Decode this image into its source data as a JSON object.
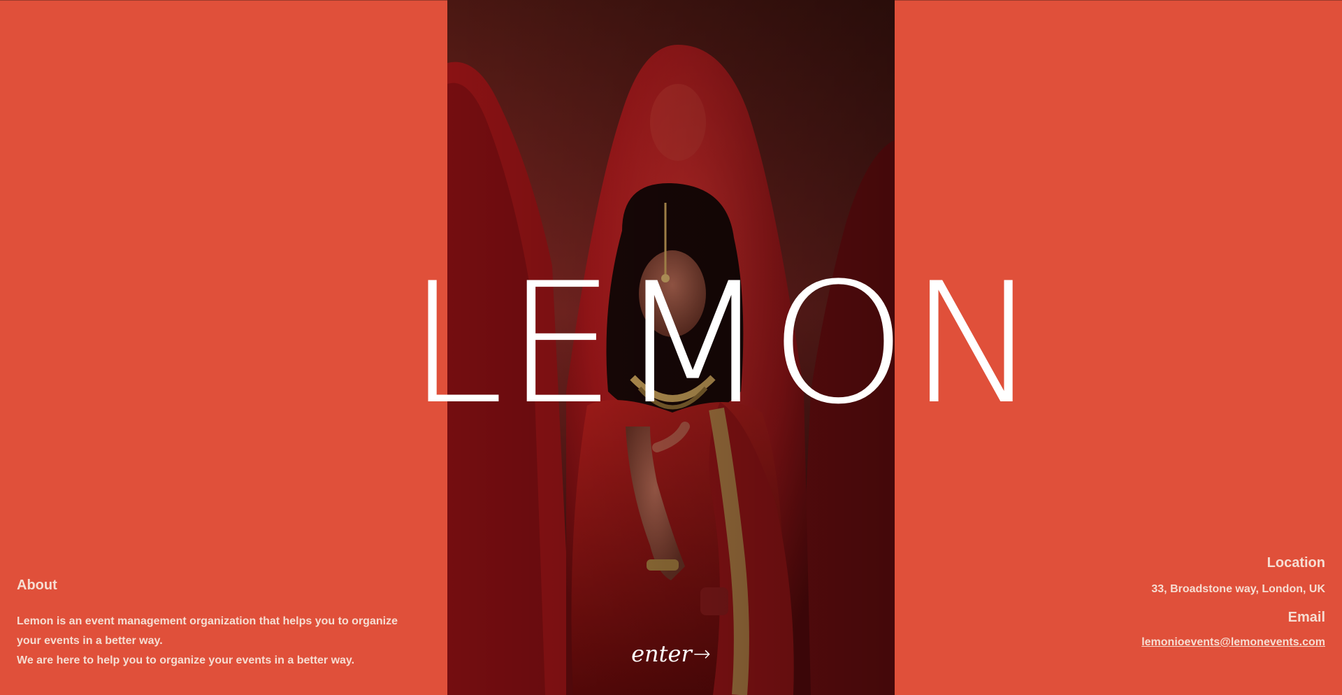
{
  "brand": {
    "wordmark": "LEMON"
  },
  "hero": {
    "enter_label": "enter",
    "enter_arrow": "→"
  },
  "about": {
    "heading": "About",
    "paragraph_1": "Lemon is an event management organization that helps you to organize your events in a better way.",
    "paragraph_2": "We are here to help you to organize your events in a better way."
  },
  "contact": {
    "location_heading": "Location",
    "location_value": "33, Broadstone way, London, UK",
    "email_heading": "Email",
    "email_value": "lemonioevents@lemonevents.com"
  },
  "colors": {
    "background": "#e0503a",
    "text_light": "#f6ddd2",
    "wordmark": "#ffffff",
    "hero_dark_red": "#5a1410"
  }
}
